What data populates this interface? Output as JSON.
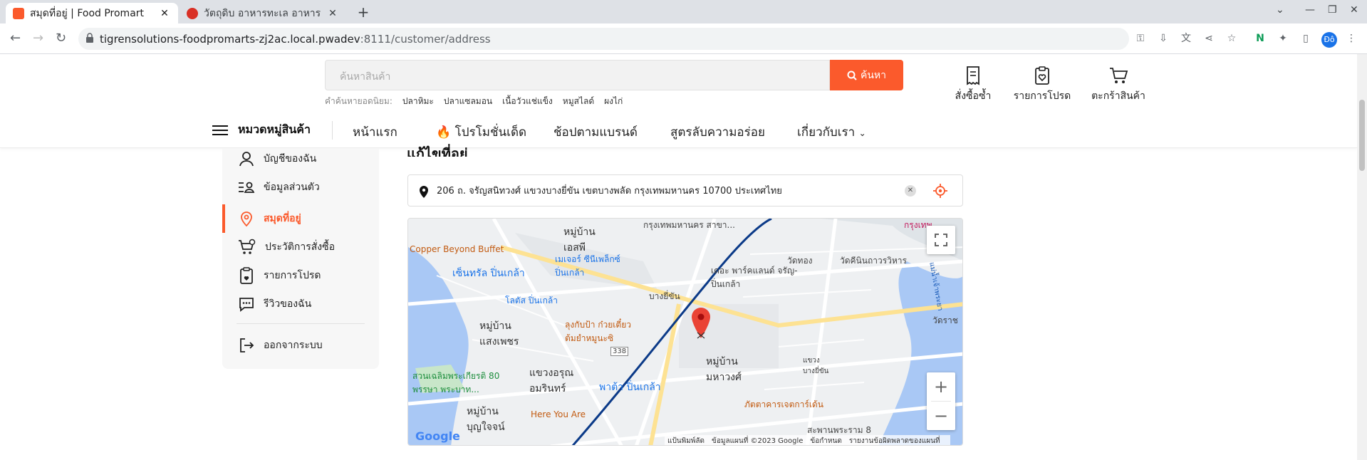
{
  "browser": {
    "tabs": [
      {
        "title": "สมุดที่อยู่ | Food Promart",
        "active": true
      },
      {
        "title": "วัตถุดิบ อาหารทะเล อาหาร",
        "active": false
      }
    ],
    "url_host": "tigrensolutions-foodpromarts-zj2ac.local.pwadev",
    "url_path": ":8111/customer/address",
    "profile_initials": "Đô"
  },
  "header": {
    "search_placeholder": "ค้นหาสินค้า",
    "search_button": "ค้นหา",
    "popular_label": "คำค้นหายอดนิยม:",
    "popular_terms": [
      "ปลาหิมะ",
      "ปลาแซลมอน",
      "เนื้อวัวแช่แข็ง",
      "หมูสไลด์",
      "ผงไก่"
    ],
    "actions": {
      "reorder": "สั่งซื้อซ้ำ",
      "wishlist": "รายการโปรด",
      "cart": "ตะกร้าสินค้า"
    }
  },
  "menu": {
    "categories": "หมวดหมู่สินค้า",
    "home": "หน้าแรก",
    "promotions": "โปรโมชั่นเด็ด",
    "brands": "ช้อปตามแบรนด์",
    "recipes": "สูตรลับความอร่อย",
    "about": "เกี่ยวกับเรา"
  },
  "sidebar": {
    "items": [
      {
        "label": "บัญชีของฉัน",
        "icon": "user-icon"
      },
      {
        "label": "ข้อมูลส่วนตัว",
        "icon": "profile-list-icon"
      },
      {
        "label": "สมุดที่อยู่",
        "icon": "location-pin-icon",
        "active": true
      },
      {
        "label": "ประวัติการสั่งซื้อ",
        "icon": "cart-history-icon"
      },
      {
        "label": "รายการโปรด",
        "icon": "clipboard-heart-icon"
      },
      {
        "label": "รีวิวของฉัน",
        "icon": "chat-icon"
      }
    ],
    "logout": "ออกจากระบบ"
  },
  "content": {
    "section_title": "แก้ไขที่อยู่",
    "address_value": "206 ถ. จรัญสนิทวงศ์ แขวงบางยี่ขัน เขตบางพลัด กรุงเทพมหานคร 10700 ประเทศไทย"
  },
  "map": {
    "labels": {
      "copper": "Copper Beyond Buffet",
      "central": "เซ็นทรัล ปิ่นเกล้า",
      "lotus": "โลตัส ปิ่นเกล้า",
      "village_sf": "หมู่บ้าน เอสพี",
      "major": "เมเจอร์ ซีนีเพล็กซ์ ปิ่นเกล้า",
      "the_park": "เดอะ พาร์คแลนด์ จรัญ-ปิ่นเกล้า",
      "bangyikhan": "บางยี่ขัน",
      "village_sp": "หมู่บ้าน แสงเพชร",
      "noodle": "ลุงกับป้า ก๋วยเตี๋ยวต้มยำหมูนะซิ",
      "arun": "แขวงอรุณ อมรินทร์",
      "pata": "พาต้า ปิ่นเกล้า",
      "village_mh": "หมู่บ้าน มหาวงศ์",
      "wat_thong": "วัดทอง",
      "wat_khi": "วัดคีนินถาวรวิหาร",
      "park": "สวนเฉลิมพระเกียรติ 80 พรรษา พระบาท...",
      "village_bj": "หมู่บ้าน บุญใจจน์",
      "here_you_are": "Here You Are",
      "restaurant": "ภัตตาคารเจตการ์เด้น",
      "bangkok": "กรุงเทพ",
      "bkk_branch": "กรุงเทพมหานคร สาขา...",
      "bang_yi_khan_area": "แขวง บางยี่ขัน",
      "bridge": "สะพานพระราม 8",
      "road_338": "338",
      "wat_rat": "วัดราช",
      "bangkok_river": "แม่น้ำเจ้าพระยา"
    },
    "footer": {
      "shortcuts": "แป้นพิมพ์ลัด",
      "data": "ข้อมูลแผนที่ ©2023 Google",
      "terms": "ข้อกำหนด",
      "report": "รายงานข้อผิดพลาดของแผนที่"
    },
    "logo": "Google"
  },
  "colors": {
    "accent": "#fb5a2c",
    "marker": "#ea4335"
  }
}
